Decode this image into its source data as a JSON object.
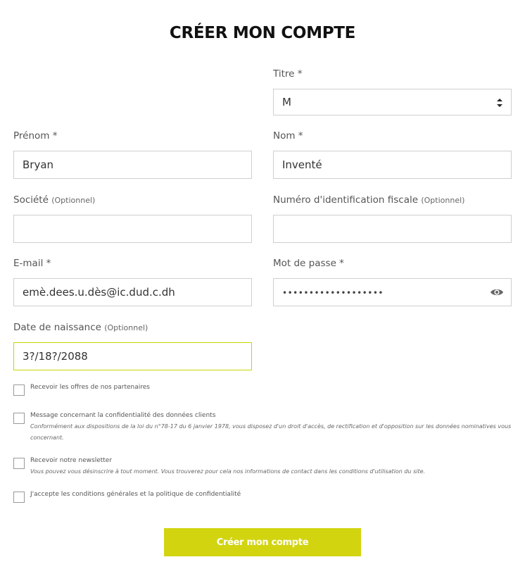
{
  "form": {
    "title": "CRÉER MON COMPTE",
    "titre": {
      "label": "Titre *",
      "value": "M"
    },
    "prenom": {
      "label": "Prénom *",
      "value": "Bryan"
    },
    "nom": {
      "label": "Nom *",
      "value": "Inventé"
    },
    "societe": {
      "label": "Société",
      "optional": "(Optionnel)",
      "value": ""
    },
    "fiscal": {
      "label": "Numéro d'identification fiscale",
      "optional": "(Optionnel)",
      "value": ""
    },
    "email": {
      "label": "E-mail *",
      "value": "emè.dees.u.dès@ic.dud.c.dh"
    },
    "password": {
      "label": "Mot de passe *",
      "value": "•••••••••••••••••••"
    },
    "birthdate": {
      "label": "Date de naissance",
      "optional": "(Optionnel)",
      "value": "3?/18?/2088"
    }
  },
  "checkboxes": [
    {
      "label": "Recevoir les offres de nos partenaires",
      "sub": ""
    },
    {
      "label": "Message concernant la confidentialité des données clients",
      "sub": "Conformément aux dispositions de la loi du n°78-17 du 6 janvier 1978, vous disposez d'un droit d'accès, de rectification et d'opposition sur les données nominatives vous concernant."
    },
    {
      "label": "Recevoir notre newsletter",
      "sub": "Vous pouvez vous désinscrire à tout moment. Vous trouverez pour cela nos informations de contact dans les conditions d'utilisation du site."
    },
    {
      "label": "J'accepte les conditions générales et la politique de confidentialité",
      "sub": ""
    }
  ],
  "submit_label": "Créer mon compte",
  "colors": {
    "accent": "#d2d410",
    "focus_border": "#c8d400"
  },
  "icons": {
    "select": "select-arrows-icon",
    "password": "eye-icon"
  }
}
